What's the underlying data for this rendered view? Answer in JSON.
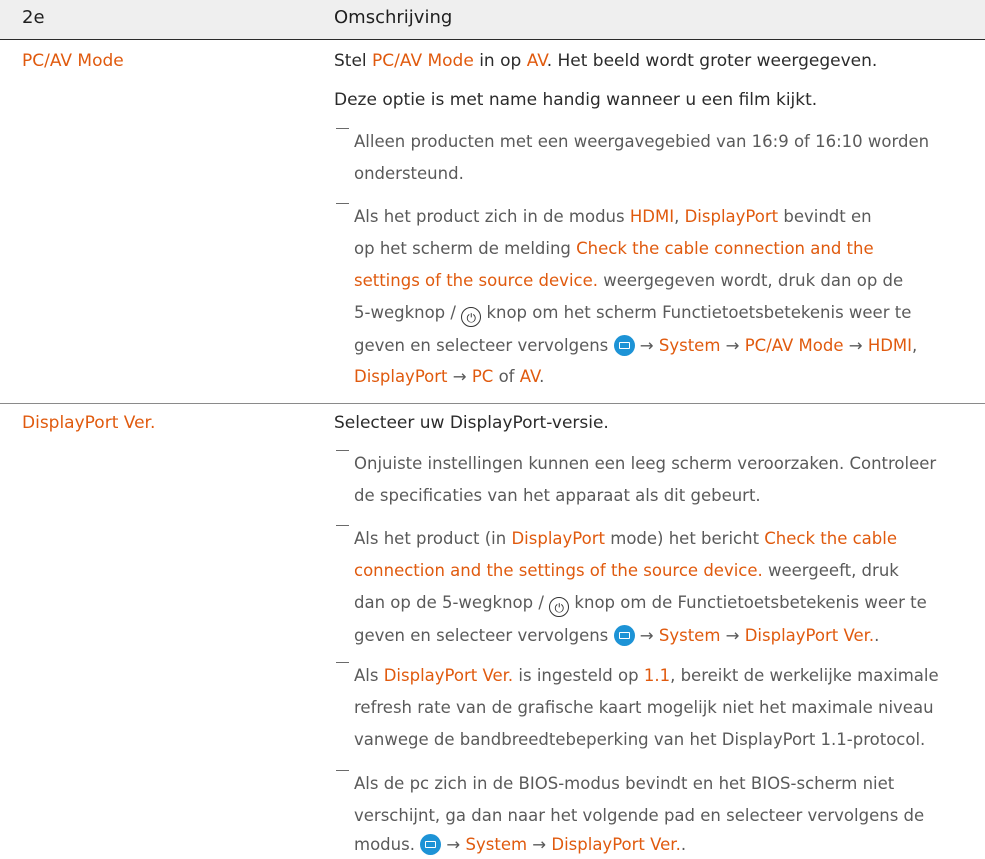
{
  "header": {
    "col1": "2e",
    "col2": "Omschrijving"
  },
  "rows": [
    {
      "name": "PC/AV Mode",
      "main_a": "Stel ",
      "main_b": "PC/AV Mode",
      "main_c": " in op ",
      "main_d": "AV",
      "main_e": ". Het beeld wordt groter weergegeven.",
      "line2": "Deze optie is met name handig wanneer u een film kijkt.",
      "note1_l1": "Alleen producten met een weergavegebied van 16:9 of 16:10 worden",
      "note1_l2": "ondersteund.",
      "note2_l1_a": "Als het product zich in de modus ",
      "note2_l1_b": "HDMI",
      "note2_l1_c": ", ",
      "note2_l1_d": "DisplayPort",
      "note2_l1_e": " bevindt en",
      "note2_l2_a": "op het scherm de melding ",
      "note2_l2_b": "Check the cable connection and the",
      "note2_l3_a": "settings of the source device.",
      "note2_l3_b": " weergegeven wordt, druk dan op de",
      "note2_l4_a": "5-wegknop / ",
      "note2_l4_b": " knop om het scherm Functietoetsbetekenis weer te",
      "note2_l5_a": "geven en selecteer vervolgens ",
      "note2_l5_b": " → ",
      "note2_l5_c": "System",
      "note2_l5_d": " → ",
      "note2_l5_e": "PC/AV Mode",
      "note2_l5_f": " → ",
      "note2_l5_g": "HDMI",
      "note2_l5_h": ",",
      "note2_l6_a": "DisplayPort",
      "note2_l6_b": " → ",
      "note2_l6_c": "PC",
      "note2_l6_d": " of ",
      "note2_l6_e": "AV",
      "note2_l6_f": "."
    },
    {
      "name": "DisplayPort Ver.",
      "main": "Selecteer uw DisplayPort-versie.",
      "note1_l1": "Onjuiste instellingen kunnen een leeg scherm veroorzaken. Controleer",
      "note1_l2": "de specificaties van het apparaat als dit gebeurt.",
      "note2_l1_a": "Als het product (in ",
      "note2_l1_b": "DisplayPort",
      "note2_l1_c": " mode) het bericht ",
      "note2_l1_d": "Check the cable",
      "note2_l2_a": "connection and the settings of the source device.",
      "note2_l2_b": " weergeeft, druk",
      "note2_l3_a": "dan op de 5-wegknop / ",
      "note2_l3_b": " knop om de Functietoetsbetekenis weer te",
      "note2_l4_a": "geven en selecteer vervolgens ",
      "note2_l4_b": " → ",
      "note2_l4_c": "System",
      "note2_l4_d": " → ",
      "note2_l4_e": "DisplayPort Ver.",
      "note2_l4_f": ".",
      "note3_l1_a": "Als ",
      "note3_l1_b": "DisplayPort Ver.",
      "note3_l1_c": " is ingesteld op ",
      "note3_l1_d": "1.1",
      "note3_l1_e": ", bereikt de werkelijke maximale",
      "note3_l2": "refresh rate van de grafische kaart mogelijk niet het maximale niveau",
      "note3_l3": "vanwege de bandbreedtebeperking van het DisplayPort 1.1-protocol.",
      "note4_l1": "Als de pc zich in de BIOS-modus bevindt en het BIOS-scherm niet",
      "note4_l2": "verschijnt, ga dan naar het volgende pad en selecteer vervolgens de",
      "note4_l3_a": "modus. ",
      "note4_l3_b": " → ",
      "note4_l3_c": "System",
      "note4_l3_d": " → ",
      "note4_l3_e": "DisplayPort Ver.",
      "note4_l3_f": "."
    }
  ],
  "icons": {
    "power": "⏻",
    "menu": "menu-icon"
  },
  "colors": {
    "accent": "#e05a0e",
    "menu_icon": "#1d93d6",
    "header_bg": "#efefef"
  }
}
